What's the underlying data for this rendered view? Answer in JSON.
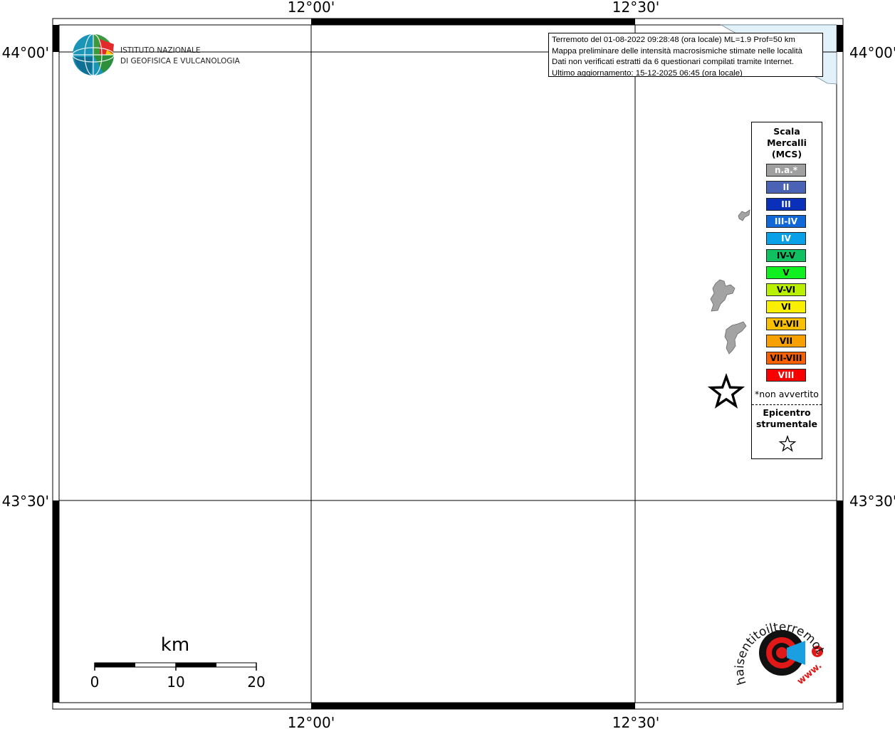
{
  "map": {
    "lon_labels": [
      "12°00'",
      "12°30'"
    ],
    "lat_labels": [
      "44°00'",
      "43°30'"
    ]
  },
  "logo": {
    "line1": "ISTITUTO NAZIONALE",
    "line2": "DI GEOFISICA E VULCANOLOGIA"
  },
  "info": {
    "line1": "Terremoto del 01-08-2022 09:28:48 (ora locale) ML=1.9 Prof=50 km",
    "line2": "Mappa preliminare delle intensità macrosismiche stimate nelle località",
    "line3": "Dati non verificati estratti da 6 questionari compilati tramite Internet.",
    "line4": "Ultimo aggiornamento: 15-12-2025 06:45 (ora locale)"
  },
  "legend": {
    "title_line1": "Scala",
    "title_line2": "Mercalli",
    "title_line3": "(MCS)",
    "items": [
      {
        "label": "n.a.*",
        "color": "#a0a0a0",
        "text_color": "#ffffff"
      },
      {
        "label": "II",
        "color": "#4a63b5",
        "text_color": "#ffffff"
      },
      {
        "label": "III",
        "color": "#0a2fb8",
        "text_color": "#ffffff"
      },
      {
        "label": "III-IV",
        "color": "#1068d8",
        "text_color": "#ffffff"
      },
      {
        "label": "IV",
        "color": "#0aa0e8",
        "text_color": "#ffffff"
      },
      {
        "label": "IV-V",
        "color": "#10c060",
        "text_color": "#000000"
      },
      {
        "label": "V",
        "color": "#10f020",
        "text_color": "#000000"
      },
      {
        "label": "V-VI",
        "color": "#b8f000",
        "text_color": "#000000"
      },
      {
        "label": "VI",
        "color": "#f8f000",
        "text_color": "#000000"
      },
      {
        "label": "VI-VII",
        "color": "#f8c000",
        "text_color": "#000000"
      },
      {
        "label": "VII",
        "color": "#f8a000",
        "text_color": "#000000"
      },
      {
        "label": "VII-VIII",
        "color": "#f86000",
        "text_color": "#000000"
      },
      {
        "label": "VIII",
        "color": "#f80000",
        "text_color": "#ffffff"
      }
    ],
    "note": "*non avvertito",
    "epicenter_line1": "Epicentro",
    "epicenter_line2": "strumentale"
  },
  "scale_bar": {
    "unit": "km",
    "ticks": [
      "0",
      "10",
      "20"
    ]
  },
  "haisentito": {
    "text": "haisentitoilterremoto.it",
    "www": "www."
  },
  "colors": {
    "sea": "#e3f2fa",
    "municipality": "#a3a3a3",
    "frame": "#000000"
  }
}
